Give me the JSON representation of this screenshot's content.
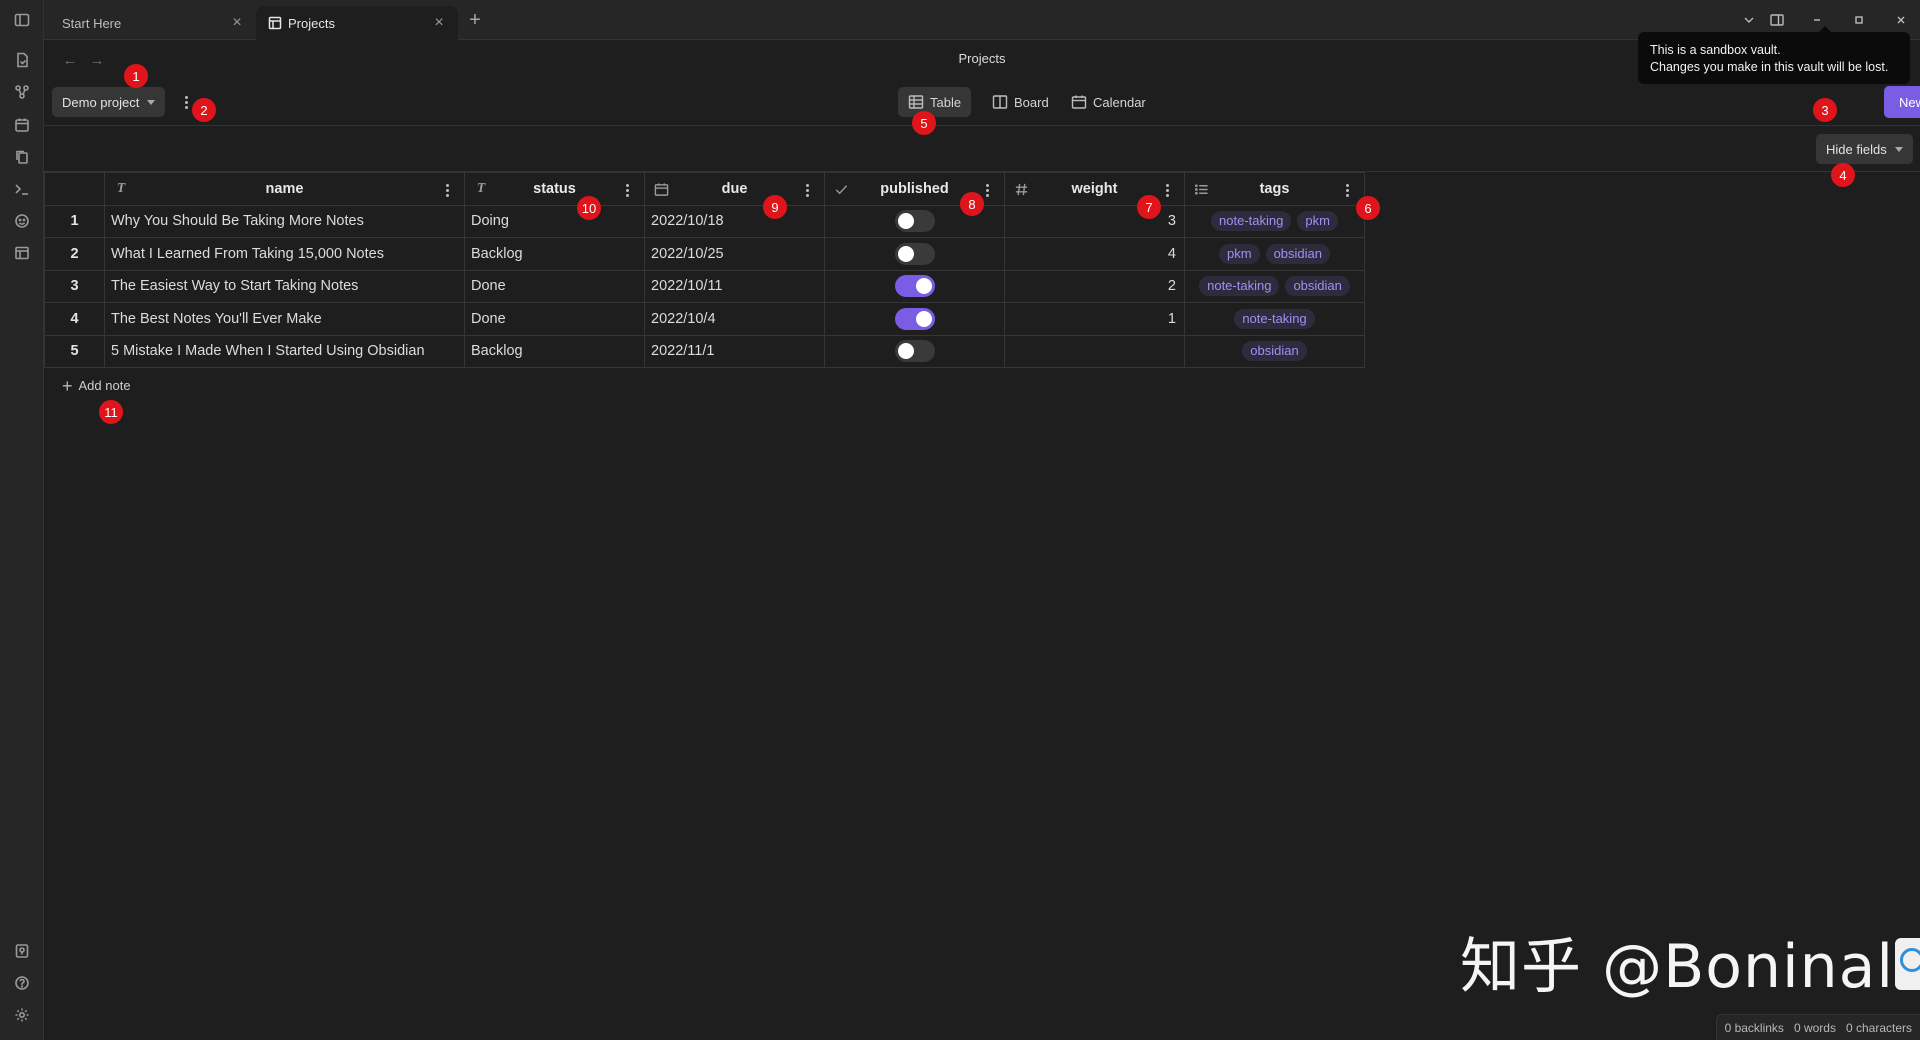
{
  "tabs": [
    {
      "label": "Start Here",
      "active": false
    },
    {
      "label": "Projects",
      "active": true
    }
  ],
  "view": {
    "title": "Projects"
  },
  "tooltip": {
    "line1": "This is a sandbox vault.",
    "line2": "Changes you make in this vault will be lost."
  },
  "toolbar": {
    "project": "Demo project",
    "views": [
      "Table",
      "Board",
      "Calendar"
    ],
    "active_view": "Table",
    "new_label": "New",
    "hide_fields_label": "Hide fields"
  },
  "table": {
    "columns": [
      {
        "name": "name",
        "icon": "text-icon"
      },
      {
        "name": "status",
        "icon": "text-icon"
      },
      {
        "name": "due",
        "icon": "calendar-icon"
      },
      {
        "name": "published",
        "icon": "check-icon"
      },
      {
        "name": "weight",
        "icon": "hash-icon"
      },
      {
        "name": "tags",
        "icon": "list-icon"
      }
    ],
    "rows": [
      {
        "idx": "1",
        "name": "Why You Should Be Taking More Notes",
        "status": "Doing",
        "due": "2022/10/18",
        "published": false,
        "weight": "3",
        "tags": [
          "note-taking",
          "pkm"
        ]
      },
      {
        "idx": "2",
        "name": "What I Learned From Taking 15,000 Notes",
        "status": "Backlog",
        "due": "2022/10/25",
        "published": false,
        "weight": "4",
        "tags": [
          "pkm",
          "obsidian"
        ]
      },
      {
        "idx": "3",
        "name": "The Easiest Way to Start Taking Notes",
        "status": "Done",
        "due": "2022/10/11",
        "published": true,
        "weight": "2",
        "tags": [
          "note-taking",
          "obsidian"
        ]
      },
      {
        "idx": "4",
        "name": "The Best Notes You'll Ever Make",
        "status": "Done",
        "due": "2022/10/4",
        "published": true,
        "weight": "1",
        "tags": [
          "note-taking"
        ]
      },
      {
        "idx": "5",
        "name": "5 Mistake I Made When I Started Using Obsidian",
        "status": "Backlog",
        "due": "2022/11/1",
        "published": false,
        "weight": "",
        "tags": [
          "obsidian"
        ]
      }
    ],
    "add_note_label": "Add note"
  },
  "badges": [
    "1",
    "2",
    "3",
    "4",
    "5",
    "6",
    "7",
    "8",
    "9",
    "10",
    "11"
  ],
  "watermark": "知乎 @Boninall",
  "status": {
    "backlinks": "0 backlinks",
    "words": "0 words",
    "characters": "0 characters"
  },
  "colors": {
    "accent": "#7b5ce4",
    "badge": "#e0151b",
    "background": "#1e1e1e"
  }
}
